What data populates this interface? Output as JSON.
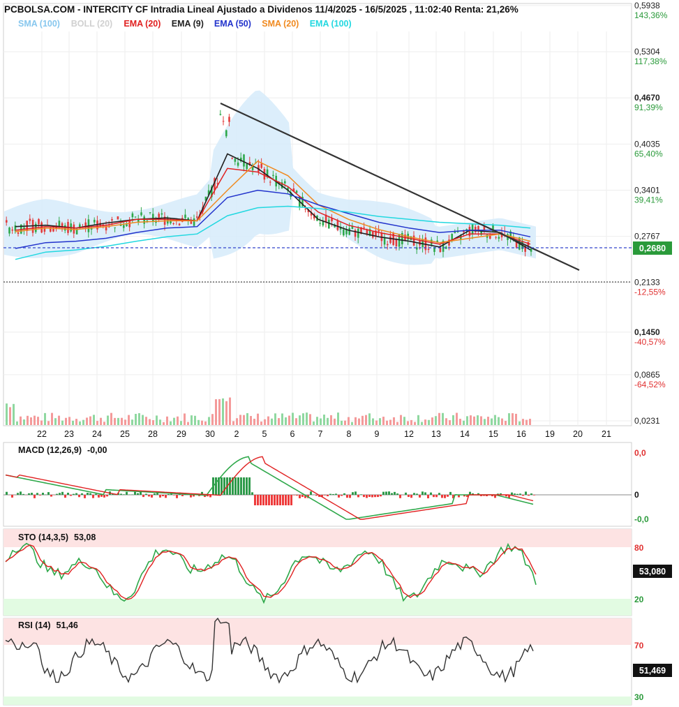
{
  "header": {
    "title": "PCBOLSA.COM - INTERCITY CF Intradia Lineal Ajustado a Dividenos 11/4/2025 - 16/5/2025 , 11:02:40 Renta: 21,26%"
  },
  "legend": [
    {
      "label": "SMA (100)",
      "color": "#87c7ee"
    },
    {
      "label": "BOLL (20)",
      "color": "#d0d0d0"
    },
    {
      "label": "EMA (20)",
      "color": "#e02020"
    },
    {
      "label": "EMA (9)",
      "color": "#202020"
    },
    {
      "label": "EMA (50)",
      "color": "#2233cc"
    },
    {
      "label": "SMA (20)",
      "color": "#f08a20"
    },
    {
      "label": "EMA (100)",
      "color": "#22d8e0"
    }
  ],
  "price_axis": [
    {
      "price": "0,5938",
      "pct": "143,36%",
      "y": 0.5938,
      "pct_color": "#2a9a3a"
    },
    {
      "price": "0,5304",
      "pct": "117,38%",
      "y": 0.5304,
      "pct_color": "#2a9a3a"
    },
    {
      "price": "0,4670",
      "pct": "91,39%",
      "y": 0.467,
      "pct_color": "#2a9a3a",
      "bold": true
    },
    {
      "price": "0,4035",
      "pct": "65,40%",
      "y": 0.4035,
      "pct_color": "#2a9a3a"
    },
    {
      "price": "0,3401",
      "pct": "39,41%",
      "y": 0.3401,
      "pct_color": "#2a9a3a"
    },
    {
      "price": "0,2767",
      "pct": "",
      "y": 0.2767,
      "pct_color": "#2a9a3a"
    },
    {
      "price": "0,2133",
      "pct": "-12,55%",
      "y": 0.2133,
      "pct_color": "#e03030"
    },
    {
      "price": "0,1450",
      "pct": "-40,57%",
      "y": 0.145,
      "pct_color": "#e03030",
      "bold": true
    },
    {
      "price": "0,0865",
      "pct": "-64,52%",
      "y": 0.0865,
      "pct_color": "#e03030"
    },
    {
      "price": "0,0231",
      "pct": "",
      "y": 0.0231,
      "pct_color": "#e03030"
    }
  ],
  "current_price": {
    "label": "0,2680",
    "value": 0.268,
    "color": "#2a9a3a"
  },
  "x_axis_labels": [
    "22",
    "23",
    "24",
    "25",
    "28",
    "29",
    "30",
    "2",
    "5",
    "6",
    "7",
    "8",
    "9",
    "12",
    "13",
    "14",
    "15",
    "16",
    "19",
    "20",
    "21"
  ],
  "macd": {
    "title": "MACD (12,26,9)",
    "value": "-0,00",
    "axis": [
      "0,0",
      "0",
      "-0,0"
    ]
  },
  "sto": {
    "title": "STO (14,3,5)",
    "value": "53,08",
    "axis": [
      "80",
      "20"
    ],
    "badge": "53,080"
  },
  "rsi": {
    "title": "RSI (14)",
    "value": "51,46",
    "axis": [
      "70",
      "30"
    ],
    "badge": "51,469"
  },
  "chart_data": {
    "type": "line",
    "title": "PCBOLSA.COM - INTERCITY CF Intradia Lineal Ajustado a Dividenos 11/4/2025 - 16/5/2025 , 11:02:40 Renta: 21,26%",
    "x": [
      "22",
      "23",
      "24",
      "25",
      "28",
      "29",
      "30",
      "2",
      "5",
      "6",
      "7",
      "8",
      "9",
      "12",
      "13",
      "14",
      "15",
      "16"
    ],
    "ylim": [
      0.0231,
      0.5938
    ],
    "series": [
      {
        "name": "EMA (9)",
        "color": "#202020",
        "values": [
          0.29,
          0.292,
          0.288,
          0.295,
          0.3,
          0.302,
          0.298,
          0.39,
          0.37,
          0.34,
          0.3,
          0.285,
          0.276,
          0.27,
          0.262,
          0.285,
          0.282,
          0.258
        ]
      },
      {
        "name": "EMA (20)",
        "color": "#e02020",
        "values": [
          0.285,
          0.29,
          0.288,
          0.292,
          0.3,
          0.3,
          0.298,
          0.37,
          0.365,
          0.345,
          0.31,
          0.292,
          0.282,
          0.274,
          0.266,
          0.28,
          0.28,
          0.266
        ]
      },
      {
        "name": "SMA (20)",
        "color": "#f08a20",
        "values": [
          0.283,
          0.288,
          0.286,
          0.29,
          0.296,
          0.298,
          0.298,
          0.34,
          0.38,
          0.36,
          0.32,
          0.3,
          0.286,
          0.276,
          0.268,
          0.274,
          0.28,
          0.27
        ]
      },
      {
        "name": "EMA (50)",
        "color": "#2233cc",
        "values": [
          0.26,
          0.268,
          0.27,
          0.274,
          0.282,
          0.288,
          0.29,
          0.33,
          0.34,
          0.335,
          0.32,
          0.308,
          0.296,
          0.288,
          0.282,
          0.285,
          0.285,
          0.276
        ]
      },
      {
        "name": "EMA (100)",
        "color": "#22d8e0",
        "values": [
          0.245,
          0.255,
          0.258,
          0.263,
          0.27,
          0.276,
          0.28,
          0.305,
          0.316,
          0.318,
          0.315,
          0.31,
          0.304,
          0.3,
          0.296,
          0.294,
          0.292,
          0.288
        ]
      }
    ]
  }
}
